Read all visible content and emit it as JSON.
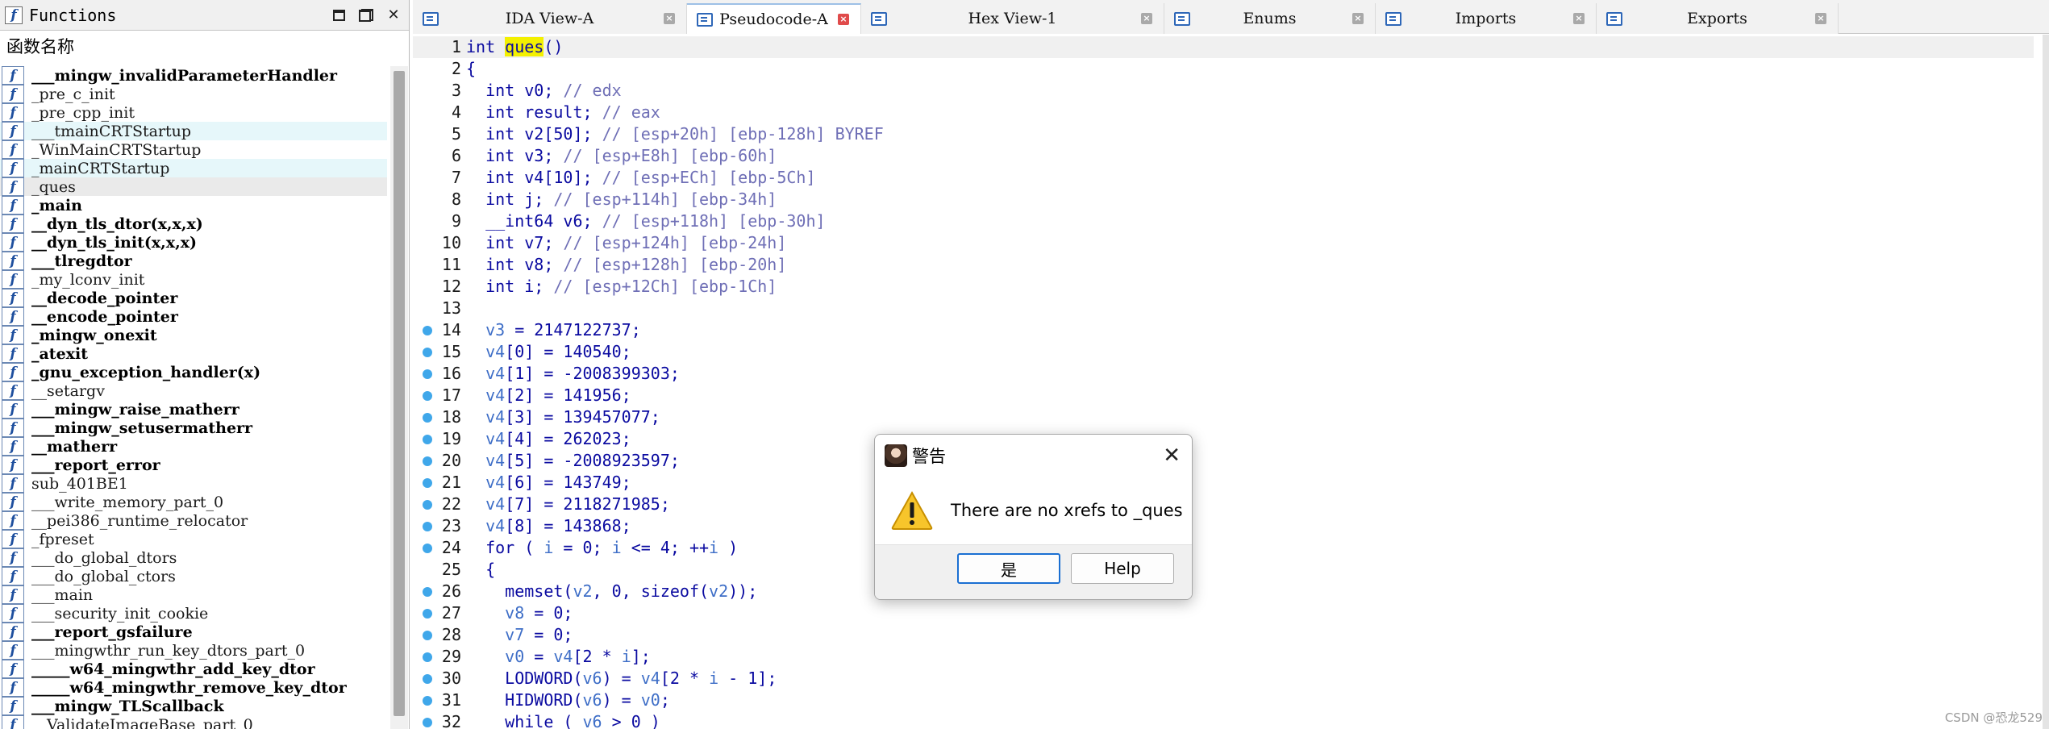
{
  "functions_pane": {
    "title": "Functions",
    "column_header": "函数名称",
    "items": [
      {
        "name": "___mingw_invalidParameterHandler",
        "bold": true,
        "hl": false
      },
      {
        "name": "_pre_c_init",
        "bold": false,
        "hl": false
      },
      {
        "name": "_pre_cpp_init",
        "bold": false,
        "hl": false
      },
      {
        "name": "___tmainCRTStartup",
        "bold": false,
        "hl": true
      },
      {
        "name": "_WinMainCRTStartup",
        "bold": false,
        "hl": false
      },
      {
        "name": "_mainCRTStartup",
        "bold": false,
        "hl": true
      },
      {
        "name": "_ques",
        "bold": false,
        "hl": false,
        "sel": true
      },
      {
        "name": "_main",
        "bold": true,
        "hl": false
      },
      {
        "name": "__dyn_tls_dtor(x,x,x)",
        "bold": true,
        "hl": false
      },
      {
        "name": "__dyn_tls_init(x,x,x)",
        "bold": true,
        "hl": false
      },
      {
        "name": "___tlregdtor",
        "bold": true,
        "hl": false
      },
      {
        "name": "_my_lconv_init",
        "bold": false,
        "hl": false
      },
      {
        "name": "__decode_pointer",
        "bold": true,
        "hl": false
      },
      {
        "name": "__encode_pointer",
        "bold": true,
        "hl": false
      },
      {
        "name": "_mingw_onexit",
        "bold": true,
        "hl": false
      },
      {
        "name": "_atexit",
        "bold": true,
        "hl": false
      },
      {
        "name": "_gnu_exception_handler(x)",
        "bold": true,
        "hl": false
      },
      {
        "name": "__setargv",
        "bold": false,
        "hl": false
      },
      {
        "name": "___mingw_raise_matherr",
        "bold": true,
        "hl": false
      },
      {
        "name": "___mingw_setusermatherr",
        "bold": true,
        "hl": false
      },
      {
        "name": "__matherr",
        "bold": true,
        "hl": false
      },
      {
        "name": "___report_error",
        "bold": true,
        "hl": false
      },
      {
        "name": "sub_401BE1",
        "bold": false,
        "hl": false
      },
      {
        "name": "___write_memory_part_0",
        "bold": false,
        "hl": false
      },
      {
        "name": "__pei386_runtime_relocator",
        "bold": false,
        "hl": false
      },
      {
        "name": "_fpreset",
        "bold": false,
        "hl": false
      },
      {
        "name": "___do_global_dtors",
        "bold": false,
        "hl": false
      },
      {
        "name": "___do_global_ctors",
        "bold": false,
        "hl": false
      },
      {
        "name": "___main",
        "bold": false,
        "hl": false
      },
      {
        "name": "___security_init_cookie",
        "bold": false,
        "hl": false
      },
      {
        "name": "___report_gsfailure",
        "bold": true,
        "hl": false
      },
      {
        "name": "___mingwthr_run_key_dtors_part_0",
        "bold": false,
        "hl": false
      },
      {
        "name": "_____w64_mingwthr_add_key_dtor",
        "bold": true,
        "hl": false
      },
      {
        "name": "_____w64_mingwthr_remove_key_dtor",
        "bold": true,
        "hl": false
      },
      {
        "name": "___mingw_TLScallback",
        "bold": true,
        "hl": false
      },
      {
        "name": "__ValidateImageBase_part_0",
        "bold": false,
        "hl": false
      }
    ]
  },
  "tabs": [
    {
      "label": "IDA View-A",
      "active": false
    },
    {
      "label": "Pseudocode-A",
      "active": true
    },
    {
      "label": "Hex View-1",
      "active": false
    },
    {
      "label": "Enums",
      "active": false
    },
    {
      "label": "Imports",
      "active": false
    },
    {
      "label": "Exports",
      "active": false
    }
  ],
  "code_lines": [
    {
      "n": "1",
      "bp": false,
      "segs": [
        [
          "t",
          "int "
        ],
        [
          "h",
          "ques"
        ],
        [
          "t",
          "()"
        ]
      ]
    },
    {
      "n": "2",
      "bp": false,
      "segs": [
        [
          "t",
          "{"
        ]
      ]
    },
    {
      "n": "3",
      "bp": false,
      "segs": [
        [
          "t",
          "  int v0; "
        ],
        [
          "c",
          "// edx"
        ]
      ]
    },
    {
      "n": "4",
      "bp": false,
      "segs": [
        [
          "t",
          "  int result; "
        ],
        [
          "c",
          "// eax"
        ]
      ]
    },
    {
      "n": "5",
      "bp": false,
      "segs": [
        [
          "t",
          "  int v2[50]; "
        ],
        [
          "c",
          "// [esp+20h] [ebp-128h] BYREF"
        ]
      ]
    },
    {
      "n": "6",
      "bp": false,
      "segs": [
        [
          "t",
          "  int v3; "
        ],
        [
          "c",
          "// [esp+E8h] [ebp-60h]"
        ]
      ]
    },
    {
      "n": "7",
      "bp": false,
      "segs": [
        [
          "t",
          "  int v4[10]; "
        ],
        [
          "c",
          "// [esp+ECh] [ebp-5Ch]"
        ]
      ]
    },
    {
      "n": "8",
      "bp": false,
      "segs": [
        [
          "t",
          "  int j; "
        ],
        [
          "c",
          "// [esp+114h] [ebp-34h]"
        ]
      ]
    },
    {
      "n": "9",
      "bp": false,
      "segs": [
        [
          "t",
          "  __int64 v6; "
        ],
        [
          "c",
          "// [esp+118h] [ebp-30h]"
        ]
      ]
    },
    {
      "n": "10",
      "bp": false,
      "segs": [
        [
          "t",
          "  int v7; "
        ],
        [
          "c",
          "// [esp+124h] [ebp-24h]"
        ]
      ]
    },
    {
      "n": "11",
      "bp": false,
      "segs": [
        [
          "t",
          "  int v8; "
        ],
        [
          "c",
          "// [esp+128h] [ebp-20h]"
        ]
      ]
    },
    {
      "n": "12",
      "bp": false,
      "segs": [
        [
          "t",
          "  int i; "
        ],
        [
          "c",
          "// [esp+12Ch] [ebp-1Ch]"
        ]
      ]
    },
    {
      "n": "13",
      "bp": false,
      "segs": [
        [
          "t",
          ""
        ]
      ]
    },
    {
      "n": "14",
      "bp": true,
      "segs": [
        [
          "t",
          "  "
        ],
        [
          "v",
          "v3"
        ],
        [
          "t",
          " = 2147122737;"
        ]
      ]
    },
    {
      "n": "15",
      "bp": true,
      "segs": [
        [
          "t",
          "  "
        ],
        [
          "v",
          "v4"
        ],
        [
          "t",
          "[0] = 140540;"
        ]
      ]
    },
    {
      "n": "16",
      "bp": true,
      "segs": [
        [
          "t",
          "  "
        ],
        [
          "v",
          "v4"
        ],
        [
          "t",
          "[1] = -2008399303;"
        ]
      ]
    },
    {
      "n": "17",
      "bp": true,
      "segs": [
        [
          "t",
          "  "
        ],
        [
          "v",
          "v4"
        ],
        [
          "t",
          "[2] = 141956;"
        ]
      ]
    },
    {
      "n": "18",
      "bp": true,
      "segs": [
        [
          "t",
          "  "
        ],
        [
          "v",
          "v4"
        ],
        [
          "t",
          "[3] = 139457077;"
        ]
      ]
    },
    {
      "n": "19",
      "bp": true,
      "segs": [
        [
          "t",
          "  "
        ],
        [
          "v",
          "v4"
        ],
        [
          "t",
          "[4] = 262023;"
        ]
      ]
    },
    {
      "n": "20",
      "bp": true,
      "segs": [
        [
          "t",
          "  "
        ],
        [
          "v",
          "v4"
        ],
        [
          "t",
          "[5] = -2008923597;"
        ]
      ]
    },
    {
      "n": "21",
      "bp": true,
      "segs": [
        [
          "t",
          "  "
        ],
        [
          "v",
          "v4"
        ],
        [
          "t",
          "[6] = 143749;"
        ]
      ]
    },
    {
      "n": "22",
      "bp": true,
      "segs": [
        [
          "t",
          "  "
        ],
        [
          "v",
          "v4"
        ],
        [
          "t",
          "[7] = 2118271985;"
        ]
      ]
    },
    {
      "n": "23",
      "bp": true,
      "segs": [
        [
          "t",
          "  "
        ],
        [
          "v",
          "v4"
        ],
        [
          "t",
          "[8] = 143868;"
        ]
      ]
    },
    {
      "n": "24",
      "bp": true,
      "segs": [
        [
          "t",
          "  for ( "
        ],
        [
          "v",
          "i"
        ],
        [
          "t",
          " = 0; "
        ],
        [
          "v",
          "i"
        ],
        [
          "t",
          " <= 4; ++"
        ],
        [
          "v",
          "i"
        ],
        [
          "t",
          " )"
        ]
      ]
    },
    {
      "n": "25",
      "bp": false,
      "segs": [
        [
          "t",
          "  {"
        ]
      ]
    },
    {
      "n": "26",
      "bp": true,
      "segs": [
        [
          "t",
          "    memset("
        ],
        [
          "v",
          "v2"
        ],
        [
          "t",
          ", 0, sizeof("
        ],
        [
          "v",
          "v2"
        ],
        [
          "t",
          "));"
        ]
      ]
    },
    {
      "n": "27",
      "bp": true,
      "segs": [
        [
          "t",
          "    "
        ],
        [
          "v",
          "v8"
        ],
        [
          "t",
          " = 0;"
        ]
      ]
    },
    {
      "n": "28",
      "bp": true,
      "segs": [
        [
          "t",
          "    "
        ],
        [
          "v",
          "v7"
        ],
        [
          "t",
          " = 0;"
        ]
      ]
    },
    {
      "n": "29",
      "bp": true,
      "segs": [
        [
          "t",
          "    "
        ],
        [
          "v",
          "v0"
        ],
        [
          "t",
          " = "
        ],
        [
          "v",
          "v4"
        ],
        [
          "t",
          "[2 * "
        ],
        [
          "v",
          "i"
        ],
        [
          "t",
          "];"
        ]
      ]
    },
    {
      "n": "30",
      "bp": true,
      "segs": [
        [
          "t",
          "    LODWORD("
        ],
        [
          "v",
          "v6"
        ],
        [
          "t",
          ") = "
        ],
        [
          "v",
          "v4"
        ],
        [
          "t",
          "[2 * "
        ],
        [
          "v",
          "i"
        ],
        [
          "t",
          " - 1];"
        ]
      ]
    },
    {
      "n": "31",
      "bp": true,
      "segs": [
        [
          "t",
          "    HIDWORD("
        ],
        [
          "v",
          "v6"
        ],
        [
          "t",
          ") = "
        ],
        [
          "v",
          "v0"
        ],
        [
          "t",
          ";"
        ]
      ]
    },
    {
      "n": "32",
      "bp": true,
      "segs": [
        [
          "t",
          "    while ( "
        ],
        [
          "v",
          "v6"
        ],
        [
          "t",
          " > 0 )"
        ]
      ]
    }
  ],
  "dialog": {
    "title": "警告",
    "message": "There are no xrefs to _ques",
    "ok_label": "是",
    "help_label": "Help",
    "close_glyph": "✕"
  },
  "watermark": "CSDN @恐龙529",
  "colors": {
    "code_text": "#0a0aa0",
    "comment": "#6f6fb6",
    "variable": "#3e6ec7",
    "highlight": "#f3f000",
    "breakpoint": "#3fa7ea",
    "active_tab_close": "#e04b4b"
  },
  "icons": {
    "function": "function-f-icon",
    "tab": "tab-view-icon",
    "warning": "warning-triangle-icon",
    "avatar": "avatar-icon"
  }
}
